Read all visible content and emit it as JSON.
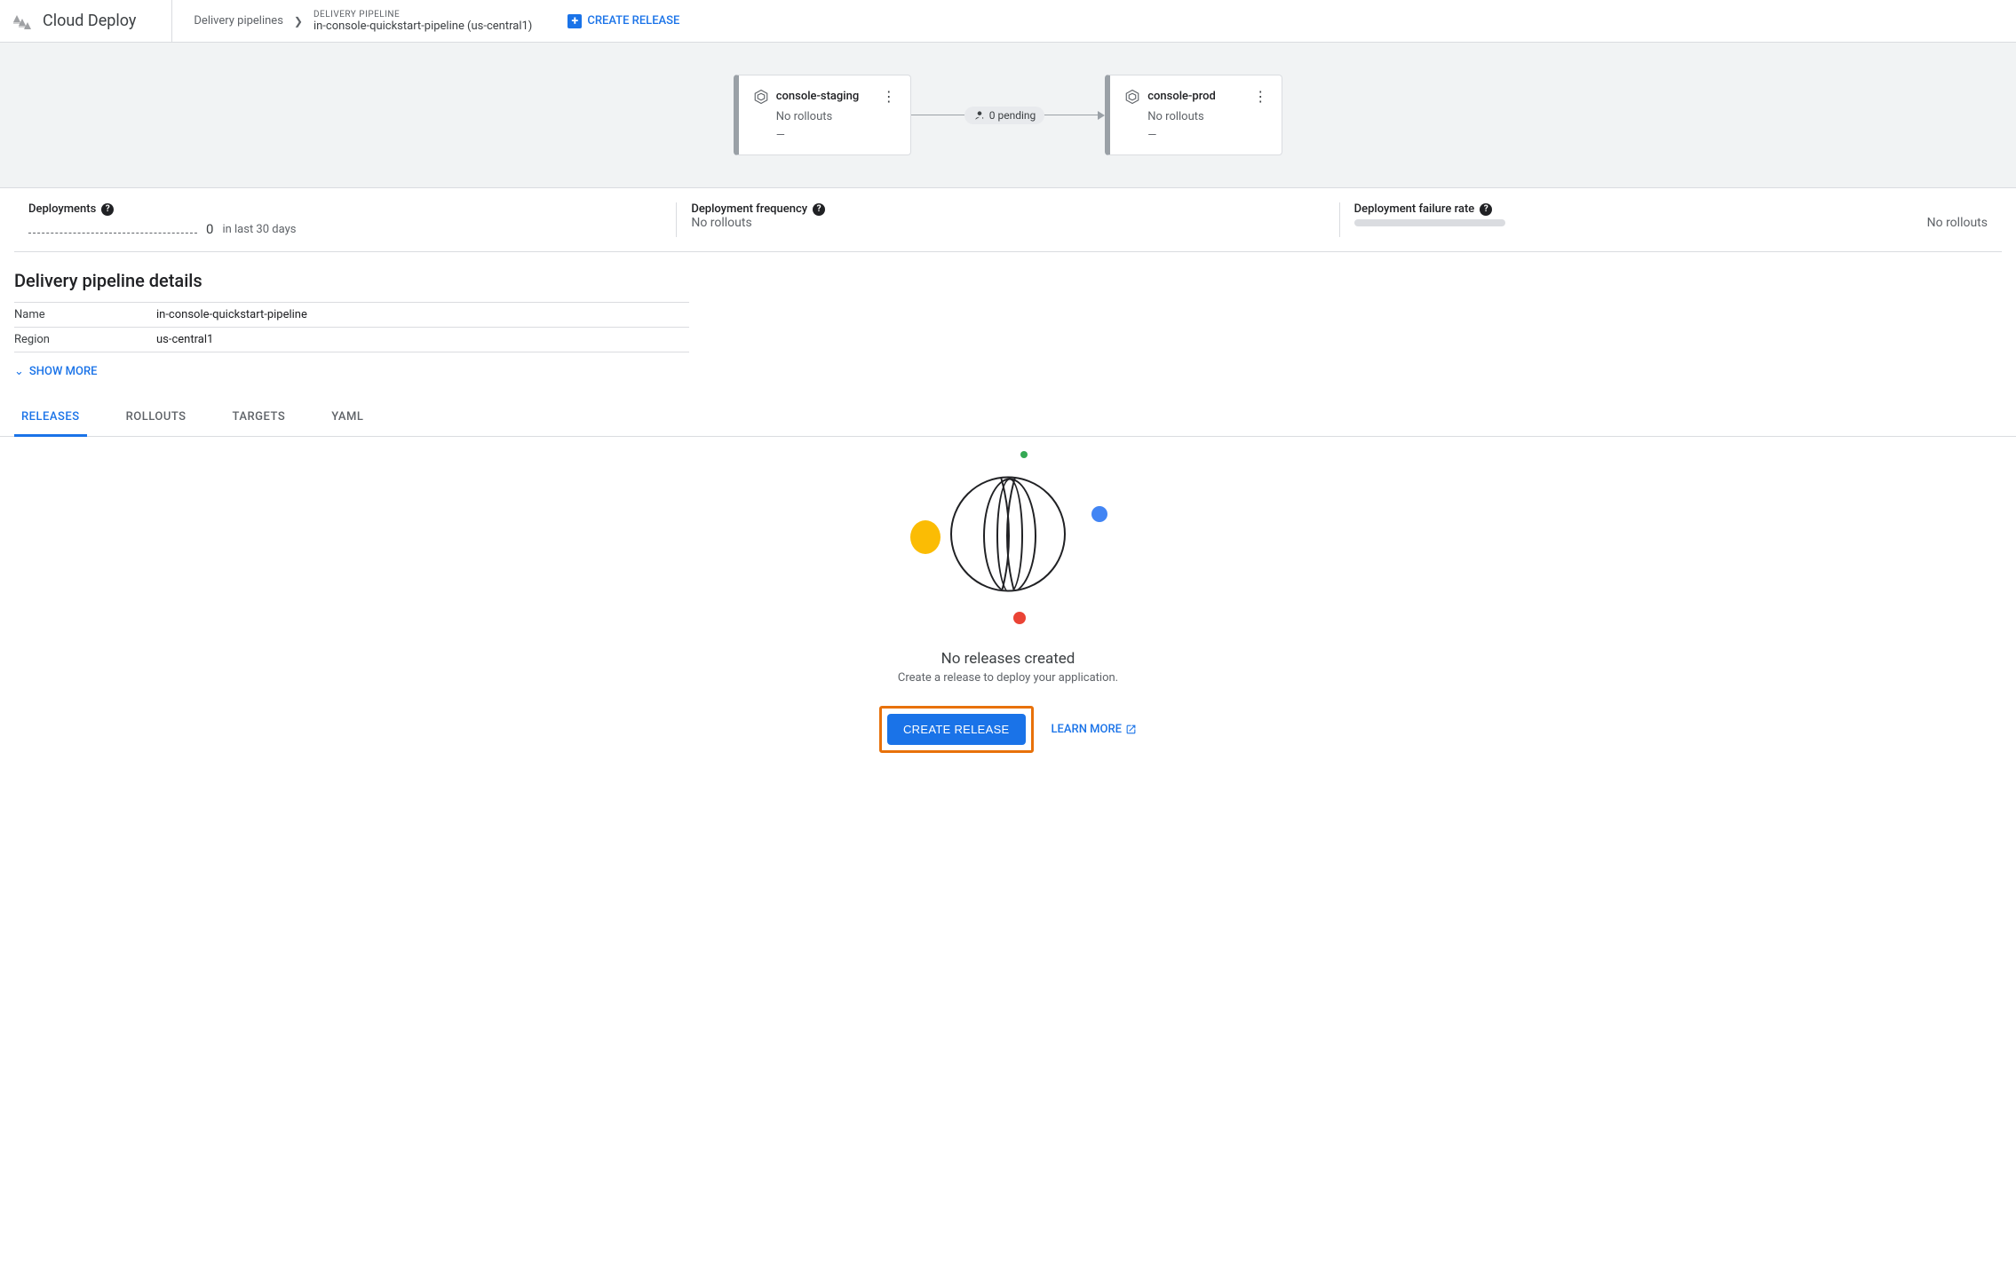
{
  "header": {
    "product": "Cloud Deploy",
    "breadcrumb_link": "Delivery pipelines",
    "breadcrumb_label": "DELIVERY PIPELINE",
    "breadcrumb_title": "in-console-quickstart-pipeline (us-central1)",
    "create_release": "CREATE RELEASE"
  },
  "pipeline": {
    "stages": [
      {
        "name": "console-staging",
        "status": "No rollouts",
        "detail": "—"
      },
      {
        "name": "console-prod",
        "status": "No rollouts",
        "detail": "—"
      }
    ],
    "pending_text": "0 pending"
  },
  "stats": {
    "deployments_label": "Deployments",
    "deployments_count": "0",
    "deployments_period": "in last 30 days",
    "frequency_label": "Deployment frequency",
    "frequency_value": "No rollouts",
    "failure_label": "Deployment failure rate",
    "failure_value": "No rollouts"
  },
  "details": {
    "heading": "Delivery pipeline details",
    "rows": [
      {
        "label": "Name",
        "value": "in-console-quickstart-pipeline"
      },
      {
        "label": "Region",
        "value": "us-central1"
      }
    ],
    "show_more": "SHOW MORE"
  },
  "tabs": [
    "RELEASES",
    "ROLLOUTS",
    "TARGETS",
    "YAML"
  ],
  "empty": {
    "title": "No releases created",
    "subtitle": "Create a release to deploy your application.",
    "cta": "CREATE RELEASE",
    "learn": "LEARN MORE"
  }
}
